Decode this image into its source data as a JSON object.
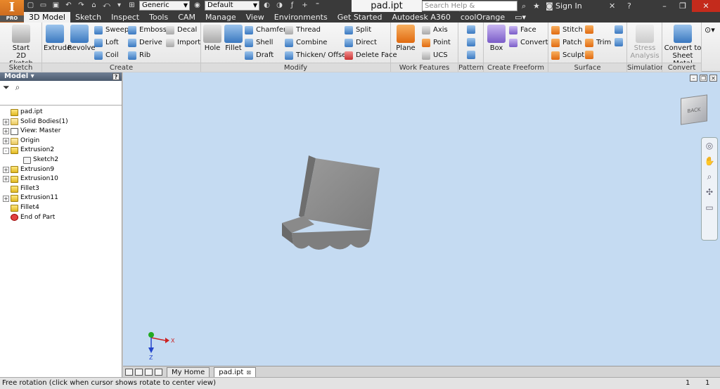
{
  "app": {
    "logo_letter": "I",
    "logo_badge": "PRO",
    "document_title": "pad.ipt"
  },
  "quick_access": {
    "appearance_combo": "Generic",
    "material_combo": "Default",
    "fx_icon": "fx-icon"
  },
  "search": {
    "placeholder": "Search Help & Commands..."
  },
  "account": {
    "signin_label": "Sign In"
  },
  "tabs": [
    "3D Model",
    "Sketch",
    "Inspect",
    "Tools",
    "CAM",
    "Manage",
    "View",
    "Environments",
    "Get Started",
    "Autodesk A360",
    "coolOrange"
  ],
  "ribbon": {
    "sketch": {
      "label": "Sketch",
      "start_line1": "Start",
      "start_line2": "2D Sketch"
    },
    "create": {
      "label": "Create",
      "extrude": "Extrude",
      "revolve": "Revolve",
      "sweep": "Sweep",
      "loft": "Loft",
      "coil": "Coil",
      "emboss": "Emboss",
      "derive": "Derive",
      "rib": "Rib",
      "decal": "Decal",
      "import": "Import"
    },
    "modify": {
      "label": "Modify",
      "hole": "Hole",
      "fillet": "Fillet",
      "chamfer": "Chamfer",
      "shell": "Shell",
      "draft": "Draft",
      "thread": "Thread",
      "combine": "Combine",
      "thicken": "Thicken/ Offset",
      "split": "Split",
      "direct": "Direct",
      "delete_face": "Delete Face"
    },
    "work_features": {
      "label": "Work Features",
      "plane": "Plane",
      "axis": "Axis",
      "point": "Point",
      "ucs": "UCS"
    },
    "pattern": {
      "label": "Pattern"
    },
    "create_freeform": {
      "label": "Create Freeform",
      "box": "Box",
      "face": "Face",
      "convert": "Convert"
    },
    "surface": {
      "label": "Surface",
      "stitch": "Stitch",
      "patch": "Patch",
      "sculpt": "Sculpt",
      "trim": "Trim"
    },
    "simulation": {
      "label": "Simulation",
      "stress_line1": "Stress",
      "stress_line2": "Analysis"
    },
    "convert": {
      "label": "Convert",
      "sheet_line1": "Convert to",
      "sheet_line2": "Sheet Metal"
    }
  },
  "browser": {
    "title": "Model",
    "help": "?",
    "tree": [
      {
        "label": "pad.ipt",
        "icon": "part-icon",
        "expander": "",
        "indent": 0
      },
      {
        "label": "Solid Bodies(1)",
        "icon": "folder-icon",
        "expander": "+",
        "indent": 0
      },
      {
        "label": "View: Master",
        "icon": "view-icon",
        "expander": "+",
        "indent": 0
      },
      {
        "label": "Origin",
        "icon": "folder-icon",
        "expander": "+",
        "indent": 0
      },
      {
        "label": "Extrusion2",
        "icon": "feature-icon",
        "expander": "-",
        "indent": 0
      },
      {
        "label": "Sketch2",
        "icon": "sketch-icon",
        "expander": "",
        "indent": 1
      },
      {
        "label": "Extrusion9",
        "icon": "feature-icon",
        "expander": "+",
        "indent": 0
      },
      {
        "label": "Extrusion10",
        "icon": "feature-icon",
        "expander": "+",
        "indent": 0
      },
      {
        "label": "Fillet3",
        "icon": "fillet-icon",
        "expander": "",
        "indent": 0
      },
      {
        "label": "Extrusion11",
        "icon": "feature-icon",
        "expander": "+",
        "indent": 0
      },
      {
        "label": "Fillet4",
        "icon": "fillet-icon",
        "expander": "",
        "indent": 0
      },
      {
        "label": "End of Part",
        "icon": "end-of-part-icon",
        "expander": "",
        "indent": 0
      }
    ]
  },
  "viewport": {
    "viewcube_label": "BACK",
    "triad": {
      "x": "X",
      "z": "Z"
    }
  },
  "doc_tabs": {
    "home": "My Home",
    "part": "pad.ipt"
  },
  "status": {
    "message": "Free rotation (click when cursor shows rotate to center view)",
    "count_1": "1",
    "count_2": "1"
  }
}
